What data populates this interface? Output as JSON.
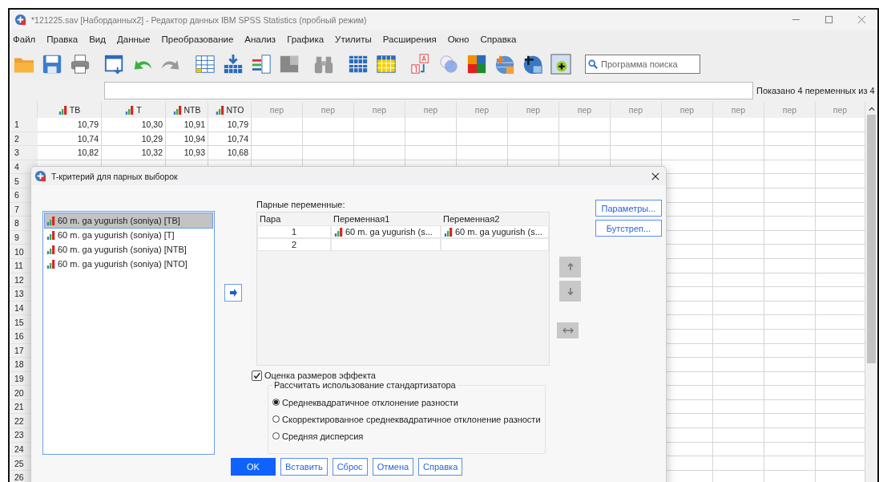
{
  "window": {
    "title": "*121225.sav [Наборданных2] - Редактор данных IBM SPSS Statistics  (пробный режим)"
  },
  "menu": [
    "Файл",
    "Правка",
    "Вид",
    "Данные",
    "Преобразование",
    "Анализ",
    "Графика",
    "Утилиты",
    "Расширения",
    "Окно",
    "Справка"
  ],
  "search": {
    "placeholder": "Программа поиска"
  },
  "variable_bar": {
    "status": "Показано 4 переменных из 4"
  },
  "grid": {
    "columns": [
      {
        "label": "TB",
        "kind": "variable"
      },
      {
        "label": "T",
        "kind": "variable"
      },
      {
        "label": "NTB",
        "kind": "variable"
      },
      {
        "label": "NTO",
        "kind": "variable"
      },
      {
        "label": "пер",
        "kind": "empty"
      },
      {
        "label": "пер",
        "kind": "empty"
      },
      {
        "label": "пер",
        "kind": "empty"
      },
      {
        "label": "пер",
        "kind": "empty"
      },
      {
        "label": "пер",
        "kind": "empty"
      },
      {
        "label": "пер",
        "kind": "empty"
      },
      {
        "label": "пер",
        "kind": "empty"
      },
      {
        "label": "пер",
        "kind": "empty"
      },
      {
        "label": "пер",
        "kind": "empty"
      },
      {
        "label": "пер",
        "kind": "empty"
      },
      {
        "label": "пер",
        "kind": "empty"
      },
      {
        "label": "пер",
        "kind": "empty"
      }
    ],
    "rows": [
      {
        "number": "1",
        "cells": [
          "10,79",
          "10,30",
          "10,91",
          "10,79"
        ]
      },
      {
        "number": "2",
        "cells": [
          "10,74",
          "10,29",
          "10,94",
          "10,74"
        ]
      },
      {
        "number": "3",
        "cells": [
          "10,82",
          "10,32",
          "10,93",
          "10,68"
        ]
      },
      {
        "number": "4"
      },
      {
        "number": "5"
      },
      {
        "number": "6"
      },
      {
        "number": "7"
      },
      {
        "number": "8"
      },
      {
        "number": "9"
      },
      {
        "number": "10"
      },
      {
        "number": "11"
      },
      {
        "number": "12"
      },
      {
        "number": "13"
      },
      {
        "number": "14"
      },
      {
        "number": "15"
      },
      {
        "number": "16"
      },
      {
        "number": "17"
      },
      {
        "number": "18"
      },
      {
        "number": "19"
      },
      {
        "number": "20"
      },
      {
        "number": "21"
      },
      {
        "number": "22"
      },
      {
        "number": "23"
      },
      {
        "number": "24"
      },
      {
        "number": "25"
      },
      {
        "number": "26"
      }
    ]
  },
  "dialog": {
    "title": "T-критерий для парных выборок",
    "source_list": [
      {
        "label": "60 m. ga yugurish (soniya) [TB]",
        "selected": true
      },
      {
        "label": "60 m. ga yugurish (soniya) [T]",
        "selected": false
      },
      {
        "label": "60 m. ga yugurish (soniya) [NTB]",
        "selected": false
      },
      {
        "label": "60 m. ga yugurish (soniya) [NTO]",
        "selected": false
      }
    ],
    "paired_label": "Парные переменные:",
    "pairs_table": {
      "columns": [
        "Пара",
        "Переменная1",
        "Переменная2"
      ],
      "rows": [
        {
          "pair": "1",
          "variable1": "60 m. ga yugurish (s...",
          "variable2": "60 m. ga yugurish (s..."
        },
        {
          "pair": "2"
        }
      ]
    },
    "side_buttons": [
      "Параметры...",
      "Бутстреп..."
    ],
    "effect_size": {
      "label": "Оценка размеров эффекта",
      "checked": true
    },
    "standardizer": {
      "legend": "Рассчитать использование стандартизатора",
      "options": [
        {
          "label": "Среднеквадратичное отклонение разности",
          "selected": true
        },
        {
          "label": "Скорректированное среднеквадратичное отклонение разности",
          "selected": false
        },
        {
          "label": "Средняя дисперсия",
          "selected": false
        }
      ]
    },
    "buttons": [
      {
        "label": "OK",
        "kind": "primary"
      },
      {
        "label": "Вставить",
        "kind": "secondary"
      },
      {
        "label": "Сброс",
        "kind": "secondary"
      },
      {
        "label": "Отмена",
        "kind": "secondary"
      },
      {
        "label": "Справка",
        "kind": "secondary"
      }
    ]
  }
}
